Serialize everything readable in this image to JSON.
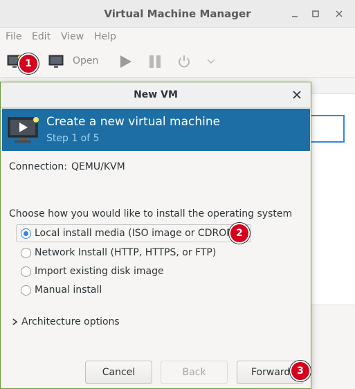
{
  "main_window": {
    "title": "Virtual Machine Manager",
    "menu": [
      "File",
      "Edit",
      "View",
      "Help"
    ],
    "toolbar": {
      "open_label": "Open"
    }
  },
  "dialog": {
    "title": "New VM",
    "banner": {
      "title": "Create a new virtual machine",
      "step": "Step 1 of 5"
    },
    "connection_label": "Connection:",
    "connection_value": "QEMU/KVM",
    "install_prompt": "Choose how you would like to install the operating system",
    "install_options": [
      {
        "label": "Local install media (ISO image or CDROM)",
        "selected": true
      },
      {
        "label": "Network Install (HTTP, HTTPS, or FTP)",
        "selected": false
      },
      {
        "label": "Import existing disk image",
        "selected": false
      },
      {
        "label": "Manual install",
        "selected": false
      }
    ],
    "architecture_label": "Architecture options",
    "buttons": {
      "cancel": "Cancel",
      "back": "Back",
      "forward": "Forward"
    }
  },
  "badges": [
    "1",
    "2",
    "3"
  ],
  "colors": {
    "banner": "#1c6ea4",
    "badge": "#d5001c",
    "accent": "#3584e4"
  }
}
